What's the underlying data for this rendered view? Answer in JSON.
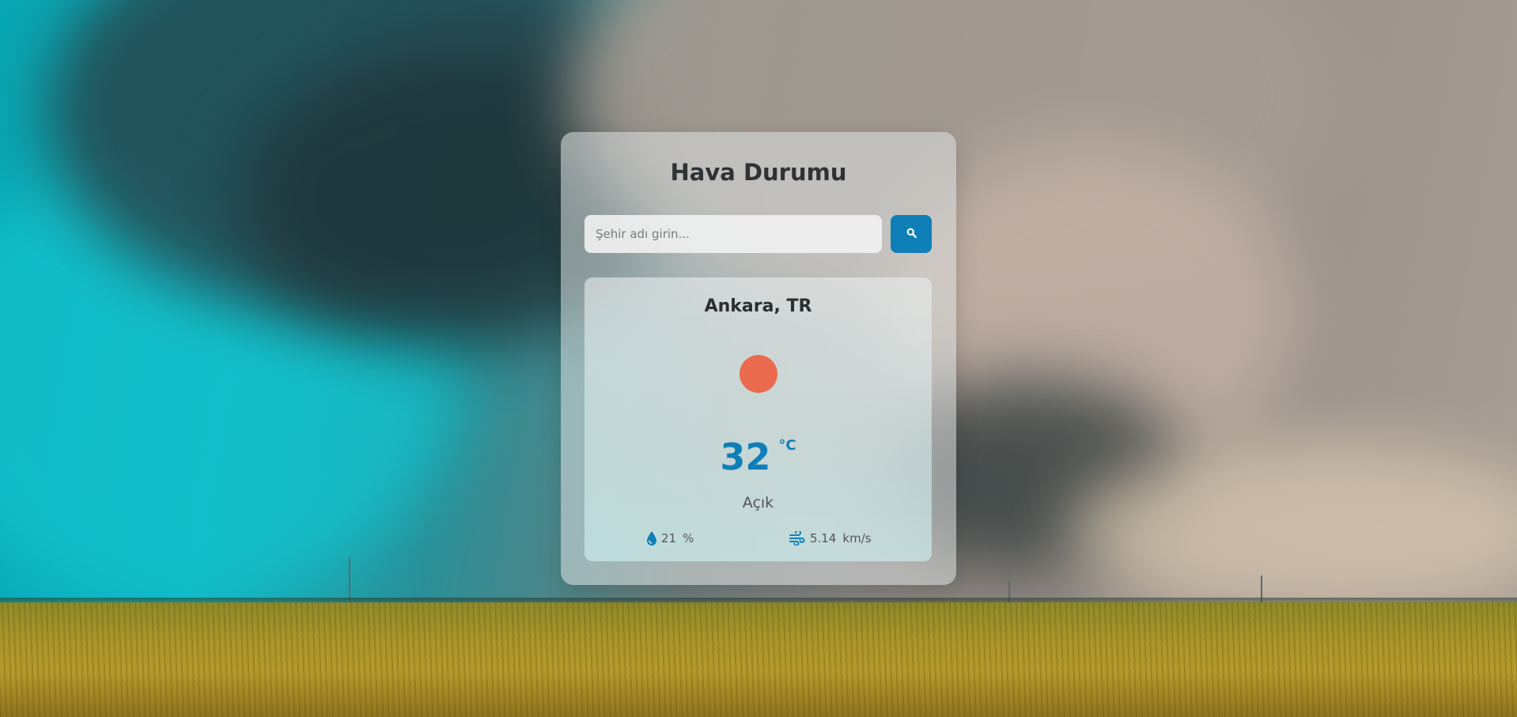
{
  "colors": {
    "accent": "#0f7fb8",
    "sun": "#ea6b4e",
    "title_text": "#2f3335"
  },
  "app": {
    "title": "Hava Durumu"
  },
  "search": {
    "placeholder": "Şehir adı girin...",
    "value": "",
    "button_icon": "search-icon"
  },
  "weather": {
    "city": "Ankara, TR",
    "condition_icon": "sun-icon",
    "temperature": "32",
    "temperature_unit": "°C",
    "description": "Açık",
    "humidity": {
      "icon": "water-drop-icon",
      "value": "21",
      "unit": "%"
    },
    "wind": {
      "icon": "wind-icon",
      "value": "5.14",
      "unit": "km/s"
    }
  }
}
